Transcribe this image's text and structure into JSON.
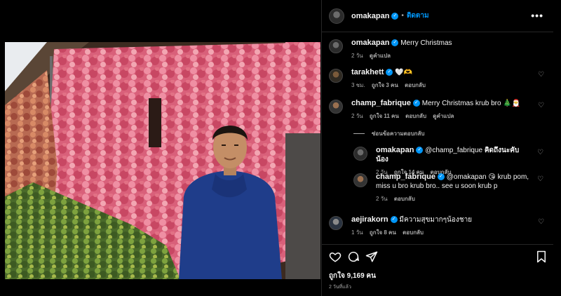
{
  "post": {
    "author": "omakapan",
    "follow_label": "ติดตาม",
    "separator": "•",
    "more_label": "•••",
    "caption": {
      "username": "omakapan",
      "text": "Merry Christmas",
      "time": "2 วัน",
      "translate": "ดูคำแปล"
    }
  },
  "comments": [
    {
      "username": "tarakhett",
      "text": "🤍🫶",
      "time": "3 ชม.",
      "likes": "ถูกใจ 3 คน",
      "reply": "ตอบกลับ"
    },
    {
      "username": "champ_fabrique",
      "text": "Merry Christmas krub bro 🎄🎅",
      "time": "2 วัน",
      "likes": "ถูกใจ 11 คน",
      "reply": "ตอบกลับ",
      "translate": "ดูคำแปล"
    },
    {
      "username": "aejirakorn",
      "text": "มีความสุขมากๆน้องชาย",
      "time": "1 วัน",
      "likes": "ถูกใจ 8 คน",
      "reply": "ตอบกลับ"
    }
  ],
  "hide_replies": "ซ่อนข้อความตอบกลับ",
  "replies": [
    {
      "username": "omakapan",
      "mention": "@champ_fabrique",
      "text": "คิดถึงนะคับน้อง",
      "time": "2 วัน",
      "likes": "ถูกใจ 14 คน",
      "reply": "ตอบกลับ"
    },
    {
      "username": "champ_fabrique",
      "mention": "@omakapan",
      "text": "😘 krub pom, miss u bro krub bro.. see u soon krub p",
      "time": "2 วัน",
      "reply": "ตอบกลับ"
    }
  ],
  "footer": {
    "likes": "ถูกใจ 9,169 คน",
    "time_ago": "2 วันที่แล้ว"
  },
  "colors": {
    "link_blue": "#0095f6",
    "muted": "#a8a8a8",
    "divider": "#262626"
  },
  "icons": [
    "heart-icon",
    "comment-icon",
    "share-icon",
    "bookmark-icon",
    "verified-badge-icon",
    "more-icon"
  ]
}
